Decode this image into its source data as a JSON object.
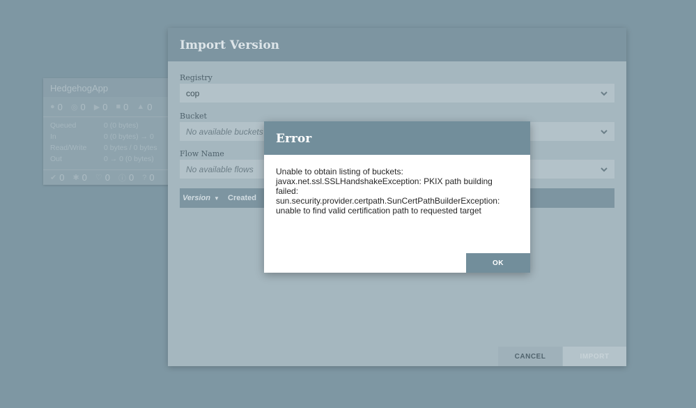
{
  "process_group": {
    "name": "HedgehogApp",
    "top_stats": [
      "0",
      "0",
      "0",
      "0",
      "0"
    ],
    "metrics": [
      {
        "label": "Queued",
        "value": "0 (0 bytes)"
      },
      {
        "label": "In",
        "value": "0 (0 bytes) → 0"
      },
      {
        "label": "Read/Write",
        "value": "0 bytes / 0 bytes"
      },
      {
        "label": "Out",
        "value": "0 → 0 (0 bytes)"
      }
    ],
    "bottom_stats": [
      "0",
      "0",
      "0",
      "0",
      "0"
    ]
  },
  "import_dialog": {
    "title": "Import Version",
    "registry_label": "Registry",
    "registry_value": "cop",
    "bucket_label": "Bucket",
    "bucket_value": "No available buckets",
    "flow_label": "Flow Name",
    "flow_value": "No available flows",
    "table_headers": {
      "version": "Version",
      "created": "Created"
    },
    "cancel_label": "CANCEL",
    "import_label": "IMPORT"
  },
  "error_modal": {
    "title": "Error",
    "message": "Unable to obtain listing of buckets: javax.net.ssl.SSLHandshakeException: PKIX path building failed: sun.security.provider.certpath.SunCertPathBuilderException: unable to find valid certification path to requested target",
    "ok_label": "OK"
  }
}
